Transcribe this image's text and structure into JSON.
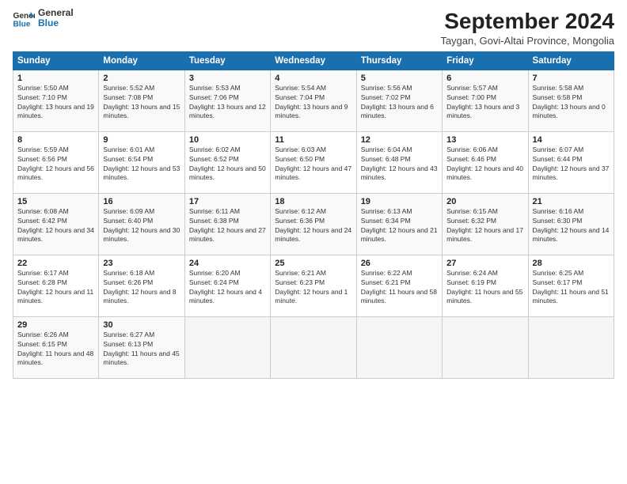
{
  "header": {
    "logo_line1": "General",
    "logo_line2": "Blue",
    "month_title": "September 2024",
    "location": "Taygan, Govi-Altai Province, Mongolia"
  },
  "weekdays": [
    "Sunday",
    "Monday",
    "Tuesday",
    "Wednesday",
    "Thursday",
    "Friday",
    "Saturday"
  ],
  "weeks": [
    [
      {
        "day": 1,
        "sunrise": "5:50 AM",
        "sunset": "7:10 PM",
        "daylight": "13 hours and 19 minutes"
      },
      {
        "day": 2,
        "sunrise": "5:52 AM",
        "sunset": "7:08 PM",
        "daylight": "13 hours and 15 minutes"
      },
      {
        "day": 3,
        "sunrise": "5:53 AM",
        "sunset": "7:06 PM",
        "daylight": "13 hours and 12 minutes"
      },
      {
        "day": 4,
        "sunrise": "5:54 AM",
        "sunset": "7:04 PM",
        "daylight": "13 hours and 9 minutes"
      },
      {
        "day": 5,
        "sunrise": "5:56 AM",
        "sunset": "7:02 PM",
        "daylight": "13 hours and 6 minutes"
      },
      {
        "day": 6,
        "sunrise": "5:57 AM",
        "sunset": "7:00 PM",
        "daylight": "13 hours and 3 minutes"
      },
      {
        "day": 7,
        "sunrise": "5:58 AM",
        "sunset": "6:58 PM",
        "daylight": "13 hours and 0 minutes"
      }
    ],
    [
      {
        "day": 8,
        "sunrise": "5:59 AM",
        "sunset": "6:56 PM",
        "daylight": "12 hours and 56 minutes"
      },
      {
        "day": 9,
        "sunrise": "6:01 AM",
        "sunset": "6:54 PM",
        "daylight": "12 hours and 53 minutes"
      },
      {
        "day": 10,
        "sunrise": "6:02 AM",
        "sunset": "6:52 PM",
        "daylight": "12 hours and 50 minutes"
      },
      {
        "day": 11,
        "sunrise": "6:03 AM",
        "sunset": "6:50 PM",
        "daylight": "12 hours and 47 minutes"
      },
      {
        "day": 12,
        "sunrise": "6:04 AM",
        "sunset": "6:48 PM",
        "daylight": "12 hours and 43 minutes"
      },
      {
        "day": 13,
        "sunrise": "6:06 AM",
        "sunset": "6:46 PM",
        "daylight": "12 hours and 40 minutes"
      },
      {
        "day": 14,
        "sunrise": "6:07 AM",
        "sunset": "6:44 PM",
        "daylight": "12 hours and 37 minutes"
      }
    ],
    [
      {
        "day": 15,
        "sunrise": "6:08 AM",
        "sunset": "6:42 PM",
        "daylight": "12 hours and 34 minutes"
      },
      {
        "day": 16,
        "sunrise": "6:09 AM",
        "sunset": "6:40 PM",
        "daylight": "12 hours and 30 minutes"
      },
      {
        "day": 17,
        "sunrise": "6:11 AM",
        "sunset": "6:38 PM",
        "daylight": "12 hours and 27 minutes"
      },
      {
        "day": 18,
        "sunrise": "6:12 AM",
        "sunset": "6:36 PM",
        "daylight": "12 hours and 24 minutes"
      },
      {
        "day": 19,
        "sunrise": "6:13 AM",
        "sunset": "6:34 PM",
        "daylight": "12 hours and 21 minutes"
      },
      {
        "day": 20,
        "sunrise": "6:15 AM",
        "sunset": "6:32 PM",
        "daylight": "12 hours and 17 minutes"
      },
      {
        "day": 21,
        "sunrise": "6:16 AM",
        "sunset": "6:30 PM",
        "daylight": "12 hours and 14 minutes"
      }
    ],
    [
      {
        "day": 22,
        "sunrise": "6:17 AM",
        "sunset": "6:28 PM",
        "daylight": "12 hours and 11 minutes"
      },
      {
        "day": 23,
        "sunrise": "6:18 AM",
        "sunset": "6:26 PM",
        "daylight": "12 hours and 8 minutes"
      },
      {
        "day": 24,
        "sunrise": "6:20 AM",
        "sunset": "6:24 PM",
        "daylight": "12 hours and 4 minutes"
      },
      {
        "day": 25,
        "sunrise": "6:21 AM",
        "sunset": "6:23 PM",
        "daylight": "12 hours and 1 minute"
      },
      {
        "day": 26,
        "sunrise": "6:22 AM",
        "sunset": "6:21 PM",
        "daylight": "11 hours and 58 minutes"
      },
      {
        "day": 27,
        "sunrise": "6:24 AM",
        "sunset": "6:19 PM",
        "daylight": "11 hours and 55 minutes"
      },
      {
        "day": 28,
        "sunrise": "6:25 AM",
        "sunset": "6:17 PM",
        "daylight": "11 hours and 51 minutes"
      }
    ],
    [
      {
        "day": 29,
        "sunrise": "6:26 AM",
        "sunset": "6:15 PM",
        "daylight": "11 hours and 48 minutes"
      },
      {
        "day": 30,
        "sunrise": "6:27 AM",
        "sunset": "6:13 PM",
        "daylight": "11 hours and 45 minutes"
      },
      null,
      null,
      null,
      null,
      null
    ]
  ]
}
